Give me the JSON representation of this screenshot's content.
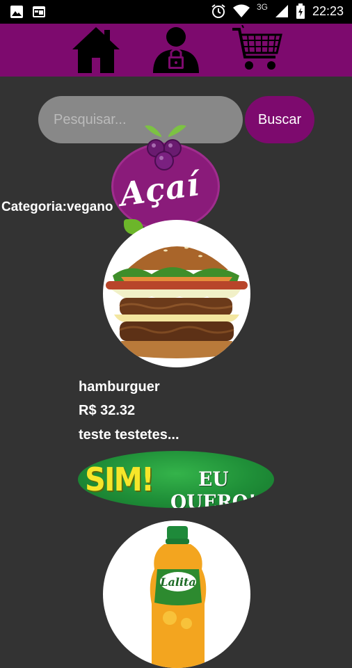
{
  "status_bar": {
    "time": "22:23",
    "network": "3G"
  },
  "nav": {
    "icons": [
      "home-icon",
      "user-lock-icon",
      "shopping-cart-icon"
    ],
    "color": "#7d0a6e"
  },
  "search": {
    "placeholder": "Pesquisar...",
    "value": "",
    "button_label": "Buscar"
  },
  "logo": {
    "text": "Açaí"
  },
  "category_label": "Categoria:vegano",
  "products": [
    {
      "name": "hamburguer",
      "price": "R$ 32.32",
      "description": "teste testetes...",
      "image": "hamburger",
      "cta": {
        "sim": "SIM!",
        "text": "EU QUERO!"
      }
    },
    {
      "image": "orange-juice-bottle",
      "brand": "Lalita"
    }
  ],
  "colors": {
    "background": "#333333",
    "accent": "#7d0a6e",
    "status_bar": "#000000",
    "search_field": "#888888"
  }
}
